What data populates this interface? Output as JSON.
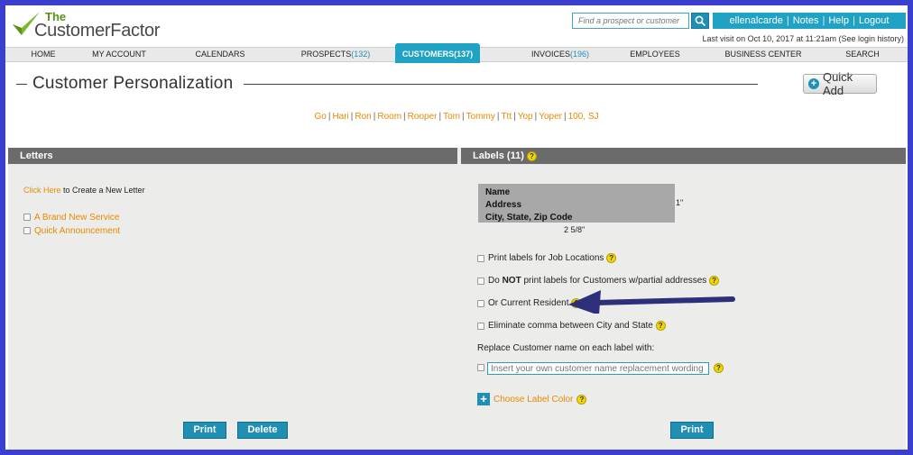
{
  "brand": {
    "the": "The",
    "name": "CustomerFactor"
  },
  "search": {
    "placeholder": "Find a prospect or customer"
  },
  "userbar": {
    "user": "ellenalcarde",
    "notes": "Notes",
    "help": "Help",
    "logout": "Logout"
  },
  "last_visit": "Last visit on Oct 10, 2017 at 11:21am (See login history)",
  "nav": {
    "home": "HOME",
    "my_account": "MY ACCOUNT",
    "calendars": "CALENDARS",
    "prospects": "PROSPECTS",
    "prospects_count": "(132)",
    "customers": "CUSTOMERS",
    "customers_count": "(137)",
    "invoices": "INVOICES",
    "invoices_count": "(196)",
    "employees": "EMPLOYEES",
    "business_center": "BUSINESS CENTER",
    "search": "SEARCH"
  },
  "page": {
    "title": "Customer Personalization",
    "quick_add": "Quick Add"
  },
  "filters": [
    "Go",
    "Hari",
    "Ron",
    "Room",
    "Rooper",
    "Tom",
    "Tommy",
    "Ttt",
    "Yop",
    "Yoper",
    "100, SJ"
  ],
  "letters": {
    "header": "Letters",
    "click_here": "Click Here",
    "create_text": " to Create a New Letter",
    "items": [
      "A Brand New Service",
      "Quick Announcement"
    ],
    "print": "Print",
    "delete": "Delete"
  },
  "labels": {
    "header": "Labels (11)",
    "preview_lines": [
      "Name",
      "Address",
      "City, State, Zip Code"
    ],
    "height": "1\"",
    "width": "2 5/8\"",
    "opt_job_locations": "Print labels for Job Locations",
    "opt_do_not_pre": "Do ",
    "opt_do_not_bold": "NOT",
    "opt_do_not_post": " print labels for Customers w/partial addresses",
    "opt_current_resident": "Or Current Resident",
    "opt_eliminate_comma": "Eliminate comma between City and State",
    "replace_heading": "Replace Customer name on each label with:",
    "replace_placeholder": "Insert your own customer name replacement wording",
    "choose_color": "Choose Label Color",
    "print": "Print",
    "help_glyph": "?"
  },
  "colors": {
    "accent": "#1fa2c4",
    "link": "#e88a00",
    "frame": "#3b3fcf",
    "arrow": "#2e2f7a"
  }
}
